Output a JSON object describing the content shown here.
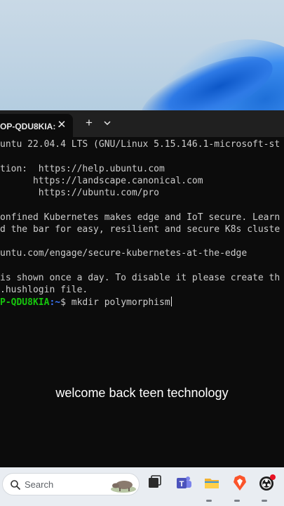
{
  "terminal": {
    "tab_title": "OP-QDU8KIA: ·",
    "lines": [
      "untu 22.04.4 LTS (GNU/Linux 5.15.146.1-microsoft-st",
      "",
      "tion:  https://help.ubuntu.com",
      "      https://landscape.canonical.com",
      "       https://ubuntu.com/pro",
      "",
      "onfined Kubernetes makes edge and IoT secure. Learn",
      "d the bar for easy, resilient and secure K8s cluste",
      "",
      "untu.com/engage/secure-kubernetes-at-the-edge",
      "",
      "is shown once a day. To disable it please create th",
      ".hushlogin file."
    ],
    "prompt": {
      "user": "P-QDU8KIA",
      "path": ":~",
      "symbol": "$ ",
      "command": "mkdir polymorphism"
    },
    "colors": {
      "prompt_user": "#16c60c",
      "prompt_path": "#3b78ff",
      "background": "#0c0c0c"
    }
  },
  "caption": "welcome back teen technology",
  "taskbar": {
    "search_placeholder": "Search",
    "apps": [
      "task-view-icon",
      "teams-icon",
      "file-explorer-icon",
      "brave-browser-icon",
      "obs-icon"
    ]
  }
}
